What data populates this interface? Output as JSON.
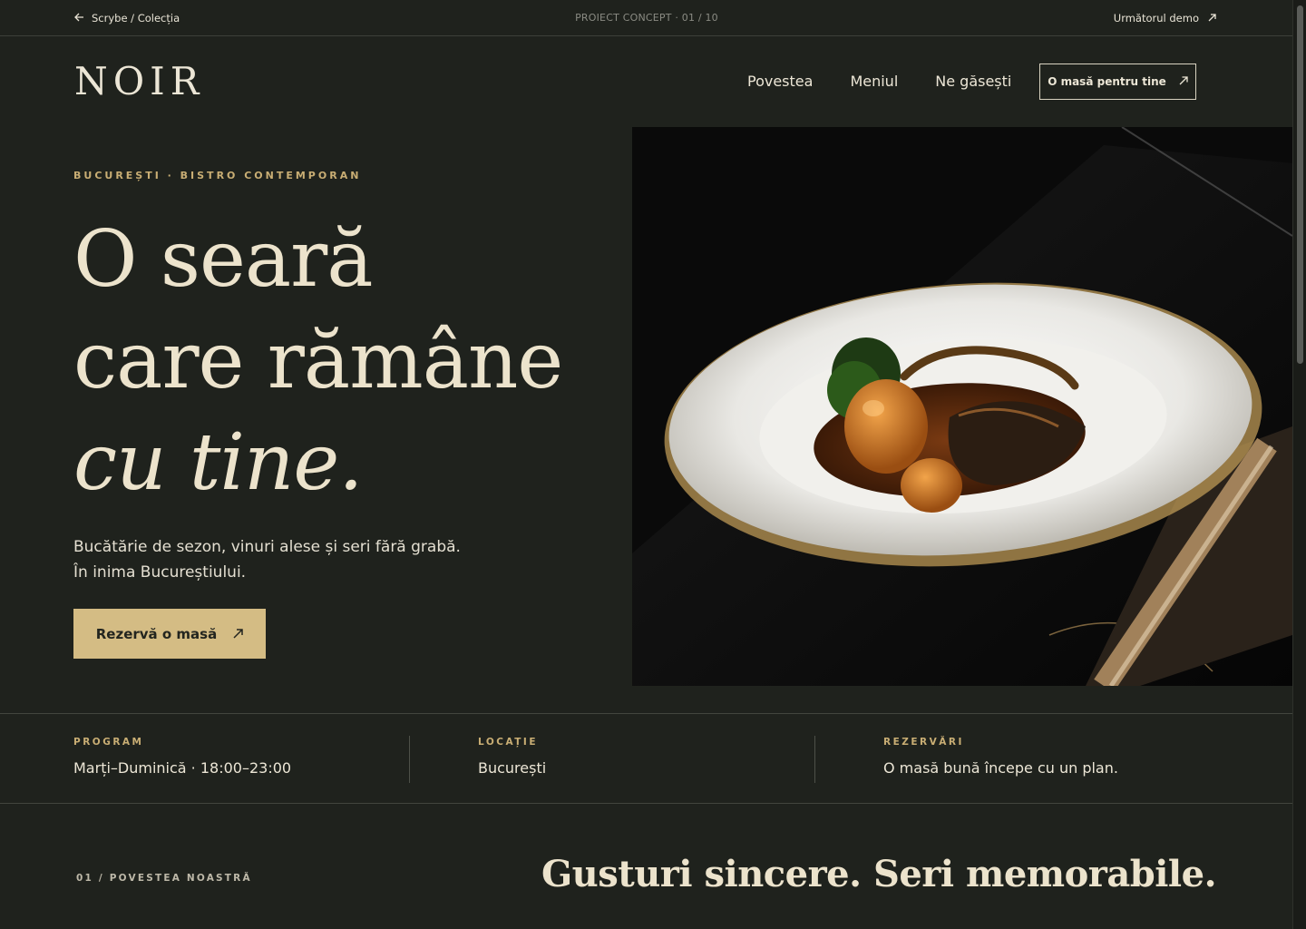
{
  "demo_bar": {
    "back_label": "Scrybe / Colecția",
    "project_label": "PROIECT CONCEPT · 01 / 10",
    "next_label": "Următorul demo"
  },
  "header": {
    "logo": "NOIR",
    "nav": [
      "Povestea",
      "Meniul",
      "Ne găsești"
    ],
    "cta_label": "O masă pentru tine"
  },
  "hero": {
    "kicker": "BUCUREȘTI · BISTRO CONTEMPORAN",
    "headline_line1": "O seară",
    "headline_line2": "care rămâne",
    "headline_line3": "cu tine.",
    "sub_line1": "Bucătărie de sezon, vinuri alese și seri fără grabă.",
    "sub_line2": "În inima Bucureștiului.",
    "cta_label": "Rezervă o masă"
  },
  "info": [
    {
      "label": "PROGRAM",
      "value": "Marți–Duminică · 18:00–23:00"
    },
    {
      "label": "LOCAȚIE",
      "value": "București"
    },
    {
      "label": "REZERVĂRI",
      "value": "O masă bună începe cu un plan."
    }
  ],
  "story": {
    "label": "01 / POVESTEA NOASTRĂ",
    "title": "Gusturi sincere. Seri memorabile."
  },
  "colors": {
    "background": "#1f221d",
    "accent_gold": "#d4bc84",
    "kicker_gold": "#c9ae74",
    "text_cream": "#ece3cc"
  }
}
